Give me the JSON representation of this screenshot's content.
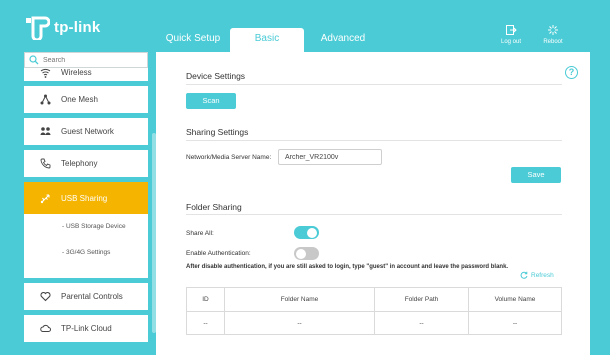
{
  "brand": {
    "name": "tp-link"
  },
  "tabs": [
    {
      "label": "Quick Setup"
    },
    {
      "label": "Basic"
    },
    {
      "label": "Advanced"
    }
  ],
  "top_actions": {
    "logout": "Log out",
    "reboot": "Reboot"
  },
  "search": {
    "placeholder": "Search"
  },
  "sidebar": {
    "items": [
      {
        "label": "Wireless",
        "icon": "wifi-icon"
      },
      {
        "label": "One Mesh",
        "icon": "mesh-icon"
      },
      {
        "label": "Guest Network",
        "icon": "guest-icon"
      },
      {
        "label": "Telephony",
        "icon": "phone-icon"
      },
      {
        "label": "USB Sharing",
        "icon": "usb-icon",
        "active": true
      },
      {
        "label": "Parental Controls",
        "icon": "heart-icon"
      },
      {
        "label": "TP-Link Cloud",
        "icon": "cloud-icon"
      }
    ],
    "subitems": [
      {
        "label": "- USB Storage Device"
      },
      {
        "label": "- 3G/4G Settings"
      }
    ]
  },
  "main": {
    "device_settings": {
      "title": "Device Settings",
      "scan_label": "Scan"
    },
    "sharing_settings": {
      "title": "Sharing Settings",
      "server_name_label": "Network/Media Server Name:",
      "server_name_value": "Archer_VR2100v",
      "save_label": "Save"
    },
    "folder_sharing": {
      "title": "Folder Sharing",
      "share_all_label": "Share All:",
      "share_all_on": true,
      "enable_auth_label": "Enable Authentication:",
      "enable_auth_on": false,
      "note": "After disable authentication, if you are still asked to login, type \"guest\" in account and leave the password blank.",
      "refresh_label": "Refresh",
      "table": {
        "headers": [
          "ID",
          "Folder Name",
          "Folder Path",
          "Volume Name"
        ],
        "rows": [
          [
            "--",
            "--",
            "--",
            "--"
          ]
        ]
      }
    }
  },
  "colors": {
    "accent": "#4acbd6",
    "active_nav": "#f5b400",
    "toggle_off": "#c8c8c8"
  }
}
